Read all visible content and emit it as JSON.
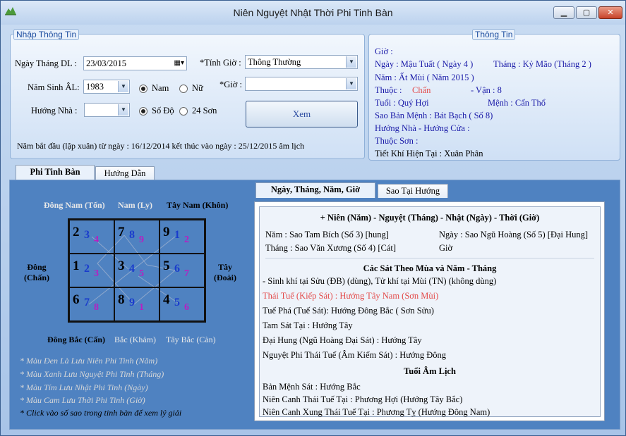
{
  "window": {
    "title": "Niên Nguyệt Nhật Thời Phi Tinh Bàn"
  },
  "input_group": {
    "legend": "Nhập Thông Tin",
    "date_label": "Ngày Tháng DL :",
    "date_value": "23/03/2015",
    "birth_year_label": "Năm Sinh ÂL:",
    "birth_year_value": "1983",
    "gender_male": "Nam",
    "gender_female": "Nữ",
    "house_dir_label": "Hướng Nhà :",
    "house_dir_value": "",
    "degree_option": "Số Độ",
    "mountains_option": "24 Sơn",
    "hour_calc_label": "*Tính Giờ :",
    "hour_calc_value": "Thông Thường",
    "hour_label": "*Giờ :",
    "hour_value": "",
    "view_button": "Xem",
    "year_note": "Năm bắt đầu (lập xuân) từ ngày : 16/12/2014 kết thúc vào ngày : 25/12/2015 âm lịch"
  },
  "info_group": {
    "legend": "Thông Tin",
    "gio": "Giờ :",
    "ngay": "Ngày :  Mậu Tuất ( Ngày 4 )",
    "thang": "Tháng :  Kỷ Mão (Tháng 2 )",
    "nam": "Năm : Ất Mùi ( Năm 2015 )",
    "thuoc_label": "Thuộc :",
    "thuoc_value": "Chấn",
    "van": "- Vận : 8",
    "tuoi": "Tuổi :   Quý Hợi",
    "menh": "Mệnh :  Cấn Thổ",
    "sao_ban_menh": "Sao Bản Mệnh :  Bát Bạch ( Số 8)",
    "huong_nha_cua": "Hướng Nhà - Hướng Cửa :",
    "thuoc_son": "Thuộc Sơn :",
    "tiet_khi": "Tiết Khí Hiện Tại : Xuân Phân"
  },
  "main_tabs": [
    "Phi Tinh Bàn",
    "Hướng Dẫn"
  ],
  "directions": {
    "se": "Đông Nam (Tốn)",
    "s": "Nam (Ly)",
    "sw": "Tây Nam (Khôn)",
    "e1": "Đông",
    "e2": "(Chấn)",
    "w1": "Tây",
    "w2": "(Đoài)",
    "ne": "Đông Bắc (Cấn)",
    "n": "Bắc (Khảm)",
    "nw": "Tây Bắc (Càn)"
  },
  "grid": [
    [
      "2",
      "3",
      "4"
    ],
    [
      "7",
      "8",
      "9"
    ],
    [
      "9",
      "1",
      "2"
    ],
    [
      "1",
      "2",
      "3"
    ],
    [
      "3",
      "4",
      "5"
    ],
    [
      "5",
      "6",
      "7"
    ],
    [
      "6",
      "7",
      "8"
    ],
    [
      "8",
      "9",
      "1"
    ],
    [
      "4",
      "5",
      "6"
    ]
  ],
  "notes": [
    "* Màu Đen Là Lưu Niên Phi Tinh (Năm)",
    "* Màu Xanh Lưu Nguyệt Phi Tinh (Tháng)",
    "* Màu Tím Lưu Nhật Phi Tinh (Ngày)",
    "* Màu Cam Lưu Thời Phi Tinh (Giờ)",
    "* Click vào số sao trong tinh bàn để xem lý giải"
  ],
  "right_tabs": [
    "Ngày, Tháng, Năm, Giờ",
    "Sao Tại Hướng"
  ],
  "details": {
    "heading": "+ Niên (Năm) - Nguyệt (Tháng) - Nhật (Ngày) - Thời (Giờ)",
    "nam": "Năm : Sao Tam Bích (Số 3) [hung]",
    "ngay": "Ngày : Sao Ngũ Hoàng (Số 5) [Đại Hung]",
    "thang": "Tháng : Sao Văn Xương (Số 4) [Cát]",
    "gio": "Giờ",
    "sat_heading": "Các Sát Theo Mùa và Năm - Tháng",
    "line1": "- Sinh khí tại Sửu (ĐB) (dùng), Tử khí tại Mùi (TN) (không dùng)",
    "line2": "Thái Tuế (Kiếp Sát) : Hướng Tây Nam (Sơn Mùi)",
    "line3": "Tuế Phá (Tuế Sát): Hướng Đông Bắc ( Sơn Sửu)",
    "line4": "Tam Sát Tại : Hướng Tây",
    "line5": "Đại Hung (Ngũ Hoàng Đại Sát) : Hướng Tây",
    "line6": "Nguyệt Phi Thái Tuế (Âm Kiếm Sát) : Hướng Đông",
    "tuoi_heading": "Tuổi Âm Lịch",
    "line7": "Bản Mệnh Sát : Hướng Bắc",
    "line8": "Niên Canh Thái Tuế Tại : Phương Hợi (Hướng Tây Bắc)",
    "line9": "Niên Canh Xung Thái Tuế Tại : Phương Tỵ (Hướng Đông Nam)"
  },
  "colors": {
    "year": "#000000",
    "month": "#1a3ccc",
    "day": "#b81ec2",
    "accent_red": "#e34a4a"
  }
}
